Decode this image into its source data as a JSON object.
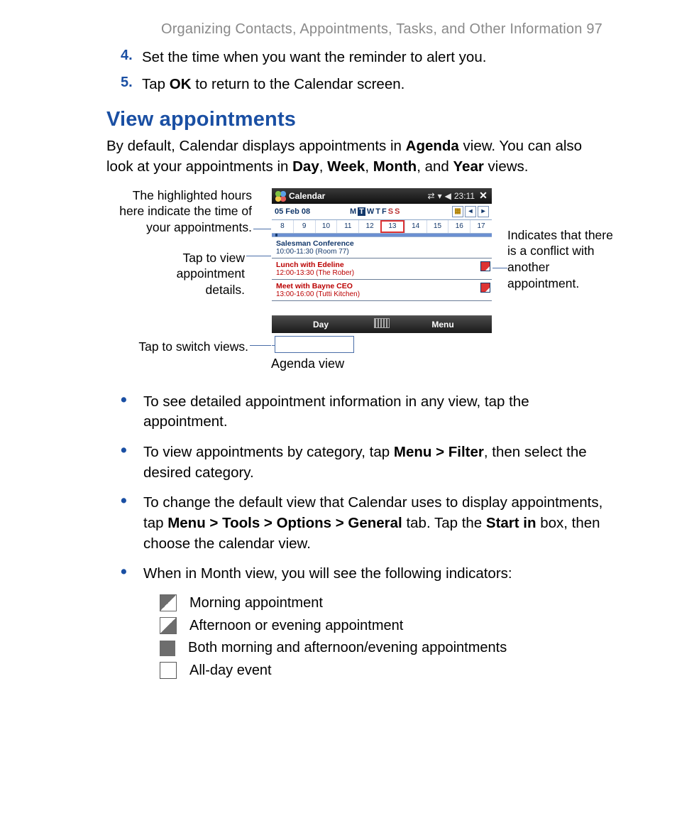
{
  "page": {
    "running_head": "Organizing Contacts, Appointments, Tasks, and Other Information  97"
  },
  "steps": {
    "s4_num": "4.",
    "s4": "Set the time when you want the reminder to alert you.",
    "s5_num": "5.",
    "s5a": "Tap ",
    "s5b": "OK",
    "s5c": " to return to the Calendar screen."
  },
  "heading": "View appointments",
  "intro": {
    "a": "By default, Calendar displays appointments in ",
    "b": "Agenda",
    "c": " view. You can also look at your appointments in ",
    "d": "Day",
    "e": ", ",
    "f": "Week",
    "g": ", ",
    "h": "Month",
    "i": ", and ",
    "j": "Year",
    "k": " views."
  },
  "callouts": {
    "hours": "The highlighted hours here indicate the time of your appointments.",
    "details": "Tap to view appointment details.",
    "switch": "Tap to switch views.",
    "conflict": "Indicates that there is a conflict with another appointment.",
    "caption": "Agenda view"
  },
  "phone": {
    "title": "Calendar",
    "clock": "23:11",
    "date": "05 Feb 08",
    "dow": [
      "M",
      "T",
      "W",
      "T",
      "F",
      "S",
      "S"
    ],
    "days": [
      "8",
      "9",
      "10",
      "11",
      "12",
      "13",
      "14",
      "15",
      "16",
      "17"
    ],
    "appts": [
      {
        "name": "Salesman Conference",
        "time": "10:00-11:30 (Room 77)",
        "conflict": false
      },
      {
        "name": "Lunch with Edeline",
        "time": "12:00-13:30 (The Rober)",
        "conflict": true
      },
      {
        "name": "Meet with Bayne CEO",
        "time": "13:00-16:00 (Tutti Kitchen)",
        "conflict": true
      }
    ],
    "soft_left": "Day",
    "soft_right": "Menu"
  },
  "bullets": {
    "b1": "To see detailed appointment information in any view, tap the appointment.",
    "b2a": "To view appointments by category, tap ",
    "b2b": "Menu > Filter",
    "b2c": ", then select the desired category.",
    "b3a": "To change the default view that Calendar uses to display appointments, tap ",
    "b3b": "Menu > Tools > Options > General",
    "b3c": " tab. Tap the ",
    "b3d": "Start in",
    "b3e": " box, then choose the calendar view.",
    "b4": "When in Month view, you will see the following indicators:"
  },
  "indicators": {
    "morning": "Morning appointment",
    "evening": "Afternoon or evening appointment",
    "both": "Both morning and afternoon/evening appointments",
    "allday": "All-day event"
  }
}
